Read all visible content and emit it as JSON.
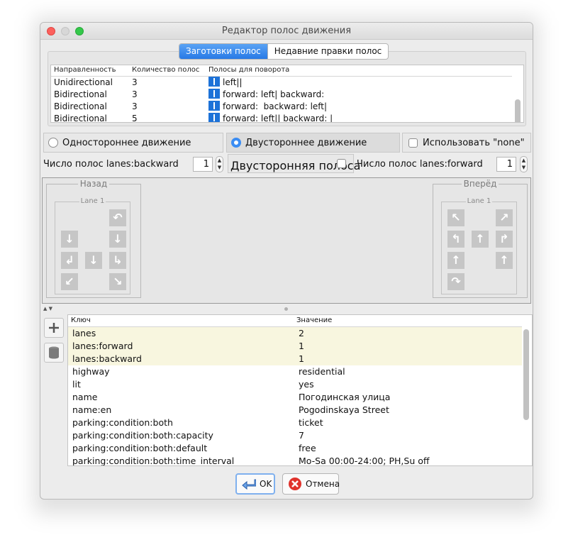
{
  "window": {
    "title": "Редактор полос движения"
  },
  "tabs": [
    {
      "label": "Заготовки полос",
      "active": true
    },
    {
      "label": "Недавние правки полос",
      "active": false
    }
  ],
  "presets": {
    "columns": [
      "Направленность",
      "Количество полос",
      "Полосы для поворота"
    ],
    "rows": [
      {
        "direction": "Unidirectional",
        "count": "3",
        "turn": "left||"
      },
      {
        "direction": "Bidirectional",
        "count": "3",
        "turn": "forward: left| backward:"
      },
      {
        "direction": "Bidirectional",
        "count": "3",
        "turn": "forward:  backward: left|"
      },
      {
        "direction": "Bidirectional",
        "count": "5",
        "turn": "forward: left|| backward: |"
      }
    ]
  },
  "direction_options": {
    "oneway": "Одностороннее движение",
    "twoway": "Двустороннее движение",
    "twoway_selected": true,
    "use_none": "Использовать \"none\""
  },
  "counts": {
    "backward_label": "Число полос lanes:backward",
    "backward_value": "1",
    "twoway_lane_label": "Двусторонняя полоса",
    "forward_label": "Число полос lanes:forward",
    "forward_value": "1"
  },
  "lanes": {
    "backward": {
      "title": "Назад",
      "lane_title": "Lane 1"
    },
    "forward": {
      "title": "Вперёд",
      "lane_title": "Lane 1"
    }
  },
  "tags": {
    "columns": [
      "Ключ",
      "Значение"
    ],
    "rows": [
      {
        "key": "lanes",
        "value": "2",
        "highlight": true
      },
      {
        "key": "lanes:forward",
        "value": "1",
        "highlight": true
      },
      {
        "key": "lanes:backward",
        "value": "1",
        "highlight": true
      },
      {
        "key": "highway",
        "value": "residential",
        "highlight": false
      },
      {
        "key": "lit",
        "value": "yes",
        "highlight": false
      },
      {
        "key": "name",
        "value": "Погодинская улица",
        "highlight": false
      },
      {
        "key": "name:en",
        "value": "Pogodinskaya Street",
        "highlight": false
      },
      {
        "key": "parking:condition:both",
        "value": "ticket",
        "highlight": false
      },
      {
        "key": "parking:condition:both:capacity",
        "value": "7",
        "highlight": false
      },
      {
        "key": "parking:condition:both:default",
        "value": "free",
        "highlight": false
      },
      {
        "key": "parking:condition:both:time_interval",
        "value": "Mo-Sa 00:00-24:00; PH,Su off",
        "highlight": false
      }
    ]
  },
  "buttons": {
    "ok": "OK",
    "cancel": "Отмена"
  },
  "colors": {
    "accent": "#2779e6",
    "highlight_row": "#f8f6df",
    "lane_icon": "#1d72d8"
  }
}
